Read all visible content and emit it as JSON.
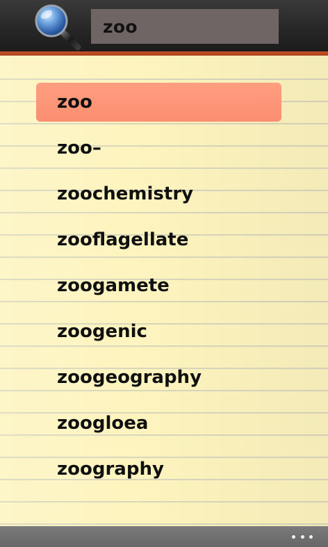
{
  "search": {
    "query": "zoo"
  },
  "results": [
    {
      "word": "zoo",
      "selected": true
    },
    {
      "word": "zoo–",
      "selected": false
    },
    {
      "word": "zoochemistry",
      "selected": false
    },
    {
      "word": "zooflagellate",
      "selected": false
    },
    {
      "word": "zoogamete",
      "selected": false
    },
    {
      "word": "zoogenic",
      "selected": false
    },
    {
      "word": "zoogeography",
      "selected": false
    },
    {
      "word": "zoogloea",
      "selected": false
    },
    {
      "word": "zoography",
      "selected": false
    }
  ],
  "icons": {
    "search": "magnifier-icon",
    "more": "ellipsis-icon"
  },
  "colors": {
    "header_bg": "#262626",
    "accent_stripe": "#c8532a",
    "search_box_bg": "#6f6565",
    "notepad_bg": "#fdf4bf",
    "selection": "#fb8e70",
    "app_bar_bg": "#707070"
  }
}
